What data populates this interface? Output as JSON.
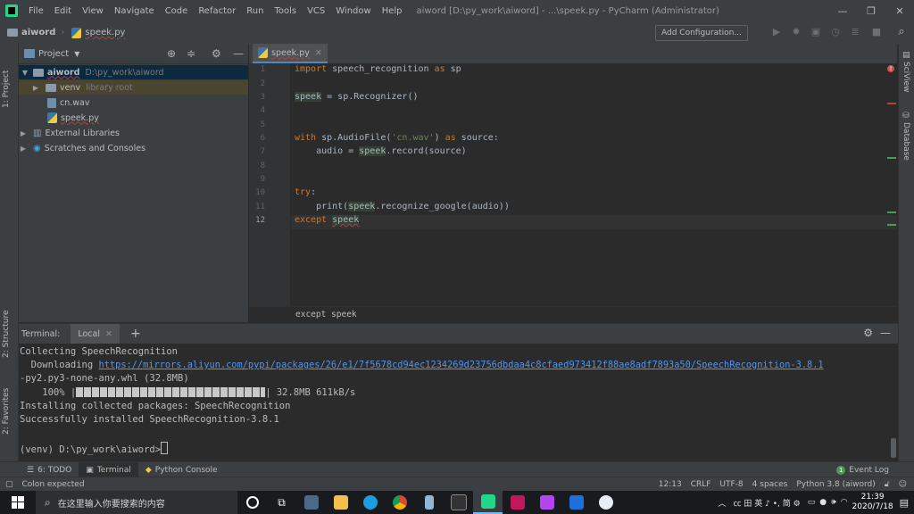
{
  "window": {
    "menus": [
      "File",
      "Edit",
      "View",
      "Navigate",
      "Code",
      "Refactor",
      "Run",
      "Tools",
      "VCS",
      "Window",
      "Help"
    ],
    "title": "aiword [D:\\py_work\\aiword] - ...\\speek.py - PyCharm (Administrator)",
    "controls": {
      "minimize": "—",
      "restore": "❐",
      "close": "✕"
    }
  },
  "navbar": {
    "project": "aiword",
    "file": "speek.py",
    "add_configuration": "Add Configuration..."
  },
  "left_strip": {
    "project": "1: Project",
    "structure": "2: Structure",
    "favorites": "2: Favorites"
  },
  "right_strip": {
    "sciview": "SciView",
    "database": "Database"
  },
  "project_panel": {
    "title": "Project",
    "root_name": "aiword",
    "root_path": "D:\\py_work\\aiword",
    "venv": "venv",
    "venv_note": "library root",
    "files": [
      "cn.wav",
      "speek.py"
    ],
    "external": "External Libraries",
    "scratches": "Scratches and Consoles"
  },
  "editor": {
    "tab": "speek.py",
    "line_numbers": [
      "1",
      "2",
      "3",
      "4",
      "5",
      "6",
      "7",
      "8",
      "9",
      "10",
      "11",
      "12"
    ],
    "current_line": "12",
    "code": {
      "l1_kw": "import",
      "l1_mod": " speech_recognition ",
      "l1_as": "as",
      "l1_alias": " sp",
      "l3_var": "speek",
      "l3_rest": " = sp.Recognizer()",
      "l6_kw": "with",
      "l6_a": " sp.AudioFile(",
      "l6_str": "'cn.wav'",
      "l6_b": ") ",
      "l6_as": "as",
      "l6_c": " source:",
      "l7_a": "    audio = ",
      "l7_var": "speek",
      "l7_b": ".record(source)",
      "l10_kw": "try",
      "l10_b": ":",
      "l11_a": "    print(",
      "l11_var": "speek",
      "l11_b": ".recognize_google(audio))",
      "l12_kw": "except",
      "l12_var": "speek"
    },
    "breadcrumb_hint": "except speek"
  },
  "terminal": {
    "label": "Terminal:",
    "tab": "Local",
    "lines": {
      "collecting": "Collecting SpeechRecognition",
      "downloading": "  Downloading ",
      "url": "https://mirrors.aliyun.com/pypi/packages/26/e1/7f5678cd94ec1234269d23756dbdaa4c8cfaed973412f88ae8adf7893a50/SpeechRecognition-3.8.1",
      "whl": "-py2.py3-none-any.whl (32.8MB)",
      "progress_pct": "    100% |",
      "progress_tail": "| 32.8MB 611kB/s",
      "installing": "Installing collected packages: SpeechRecognition",
      "success": "Successfully installed SpeechRecognition-3.8.1",
      "prompt": "(venv) D:\\py_work\\aiword>"
    },
    "progress": 1.0
  },
  "tool_tabs": {
    "todo": "6: TODO",
    "terminal": "Terminal",
    "python_console": "Python Console",
    "event_log": "Event Log",
    "event_count": "1"
  },
  "statusbar": {
    "message": "Colon expected",
    "position": "12:13",
    "line_sep": "CRLF",
    "encoding": "UTF-8",
    "indent": "4 spaces",
    "interpreter": "Python 3.8 (aiword)"
  },
  "taskbar": {
    "search_placeholder": "在这里输入你要搜索的内容",
    "tray_text": "㏄ 田 英 ♪ •, 简 ⚙",
    "time": "21:39",
    "date": "2020/7/18"
  },
  "colors": {
    "accent": "#4a88c7",
    "keyword": "#cc7832",
    "string": "#6a8759",
    "link": "#5394ec"
  }
}
